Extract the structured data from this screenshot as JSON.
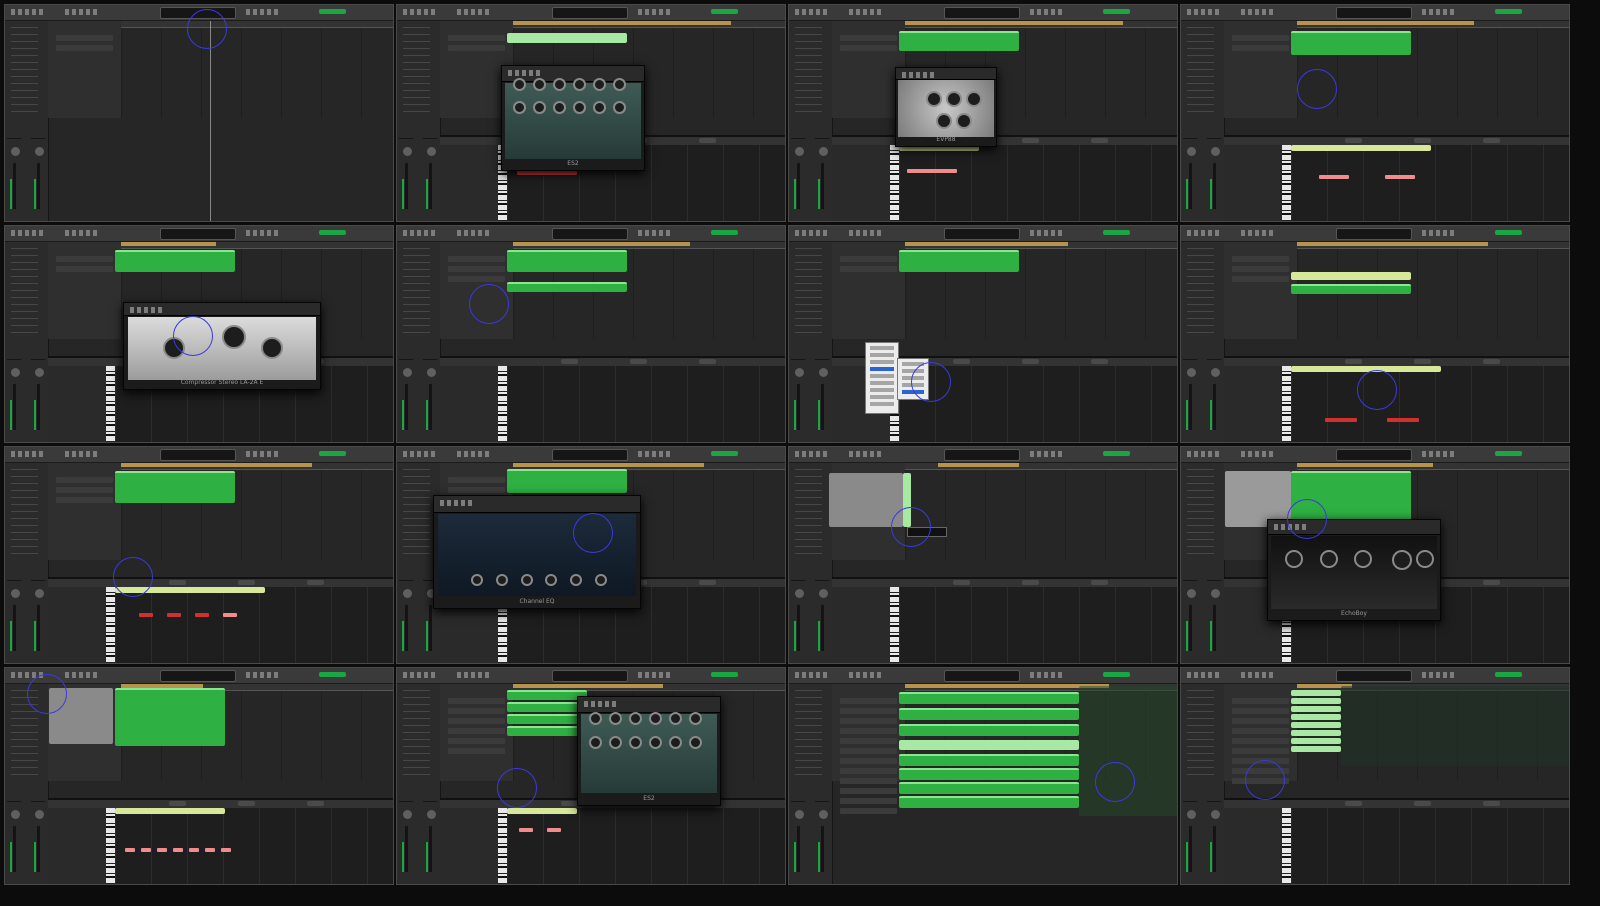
{
  "contact_sheet": {
    "columns": 4,
    "rows": 4,
    "frames": [
      {
        "id": 1,
        "scene": "empty project"
      },
      {
        "id": 2,
        "scene": "ES2 synth plugin open",
        "plugin": "ES2"
      },
      {
        "id": 3,
        "scene": "EVP88 electric piano plugin open",
        "plugin": "EVP88"
      },
      {
        "id": 4,
        "scene": "piano roll editor with pink notes"
      },
      {
        "id": 5,
        "scene": "compressor plugin open",
        "plugin": "Compressor Stereo LA-2A E"
      },
      {
        "id": 6,
        "scene": "arrange with empty piano roll"
      },
      {
        "id": 7,
        "scene": "mixer context menu open"
      },
      {
        "id": 8,
        "scene": "piano roll with red notes and automation line"
      },
      {
        "id": 9,
        "scene": "piano roll with red notes, cursor highlight"
      },
      {
        "id": 10,
        "scene": "Channel EQ plugin open",
        "plugin": "Channel EQ"
      },
      {
        "id": 11,
        "scene": "instrument library with tooltip"
      },
      {
        "id": 12,
        "scene": "EchoBoy plugin open",
        "plugin": "EchoBoy"
      },
      {
        "id": 13,
        "scene": "drum kit library, pink notes"
      },
      {
        "id": 14,
        "scene": "ES2 plugin open over many tracks",
        "plugin": "ES2"
      },
      {
        "id": 15,
        "scene": "many tracks with long regions"
      },
      {
        "id": 16,
        "scene": "track list with small regions"
      }
    ]
  },
  "colors": {
    "region_green": "#2fb042",
    "region_yellow": "#d8e89a",
    "note_red": "#e04040",
    "note_pink": "#f08c8c",
    "cursor_circle": "#3a3ae0",
    "cycle_bar": "#b8934d",
    "background": "#262626"
  },
  "plugins": {
    "es2": "ES2",
    "evp": "EVP88",
    "comp": "Compressor Stereo LA-2A E",
    "eq": "Channel EQ",
    "echo": "EchoBoy"
  }
}
